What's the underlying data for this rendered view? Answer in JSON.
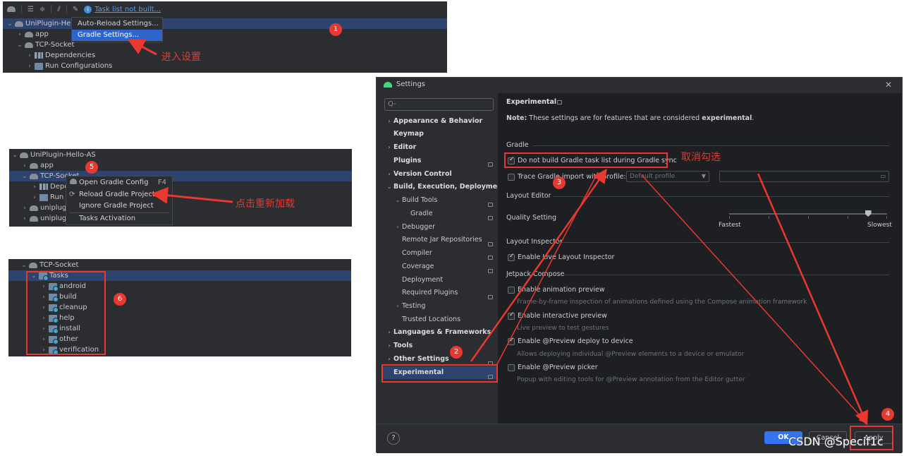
{
  "panel1": {
    "toolbar": {
      "task_status_link": "Task list not built..."
    },
    "tree": [
      "UniPlugin-Hello",
      "app",
      "TCP-Socket",
      "Dependencies",
      "Run Configurations"
    ],
    "menu": [
      "Auto-Reload Settings...",
      "Gradle Settings..."
    ],
    "annotation": "进入设置",
    "badge": "1"
  },
  "panel2": {
    "tree": [
      "UniPlugin-Hello-AS",
      "app",
      "TCP-Socket",
      "Depe",
      "Run C",
      "uniplugi",
      "uniplugi"
    ],
    "menu": [
      {
        "label": "Open Gradle Config",
        "shortcut": "F4"
      },
      {
        "label": "Reload Gradle Project",
        "shortcut": ""
      },
      {
        "label": "Ignore Gradle Project",
        "shortcut": ""
      },
      {
        "label": "Tasks Activation",
        "shortcut": ""
      }
    ],
    "annotation": "点击重新加载",
    "badge": "5"
  },
  "panel3": {
    "tree": [
      "TCP-Socket",
      "Tasks",
      "android",
      "build",
      "cleanup",
      "help",
      "install",
      "other",
      "verification"
    ],
    "badge": "6"
  },
  "settings": {
    "title": "Settings",
    "search_placeholder": "Q-",
    "nav": [
      "Appearance & Behavior",
      "Keymap",
      "Editor",
      "Plugins",
      "Version Control",
      "Build, Execution, Deployment",
      "Build Tools",
      "Gradle",
      "Debugger",
      "Remote Jar Repositories",
      "Compiler",
      "Coverage",
      "Deployment",
      "Required Plugins",
      "Testing",
      "Trusted Locations",
      "Languages & Frameworks",
      "Tools",
      "Other Settings",
      "Experimental"
    ],
    "content": {
      "heading": "Experimental",
      "note_label": "Note:",
      "note_text": "These settings are for features that are considered",
      "note_bold": "experimental",
      "note_end": ".",
      "gradle_section": "Gradle",
      "opt_no_build_tasks": "Do not build Gradle task list during Gradle sync",
      "opt_trace_import": "Trace Gradle import with profile:",
      "profile_dropdown": "Default profile",
      "layout_editor": "Layout Editor",
      "quality_setting": "Quality Setting",
      "fastest": "Fastest",
      "slowest": "Slowest",
      "quality_level": 0.88,
      "layout_inspector": "Layout Inspector",
      "opt_live_inspector": "Enable Live Layout Inspector",
      "jetpack_compose": "Jetpack Compose",
      "opt_animation_preview": "Enable animation preview",
      "animation_preview_desc": "Frame-by-frame inspection of animations defined using the Compose animation framework",
      "opt_interactive_preview": "Enable interactive preview",
      "interactive_preview_desc": "Live preview to test gestures",
      "opt_preview_deploy": "Enable @Preview deploy to device",
      "preview_deploy_desc": "Allows deploying individual @Preview elements to a device or emulator",
      "opt_preview_picker": "Enable @Preview picker",
      "preview_picker_desc": "Popup with editing tools for @Preview annotation from the Editor gutter"
    },
    "footer": {
      "help": "?",
      "ok": "OK",
      "cancel": "Cancel",
      "apply": "Apply"
    }
  },
  "annotations": {
    "uncheck": "取消勾选",
    "badge2": "2",
    "badge3": "3",
    "badge4": "4"
  },
  "watermark": "CSDN @Specif1c",
  "colors": {
    "annotation_red": "#e8382f",
    "selection_blue": "#2e436e",
    "primary_button": "#3574f0"
  }
}
